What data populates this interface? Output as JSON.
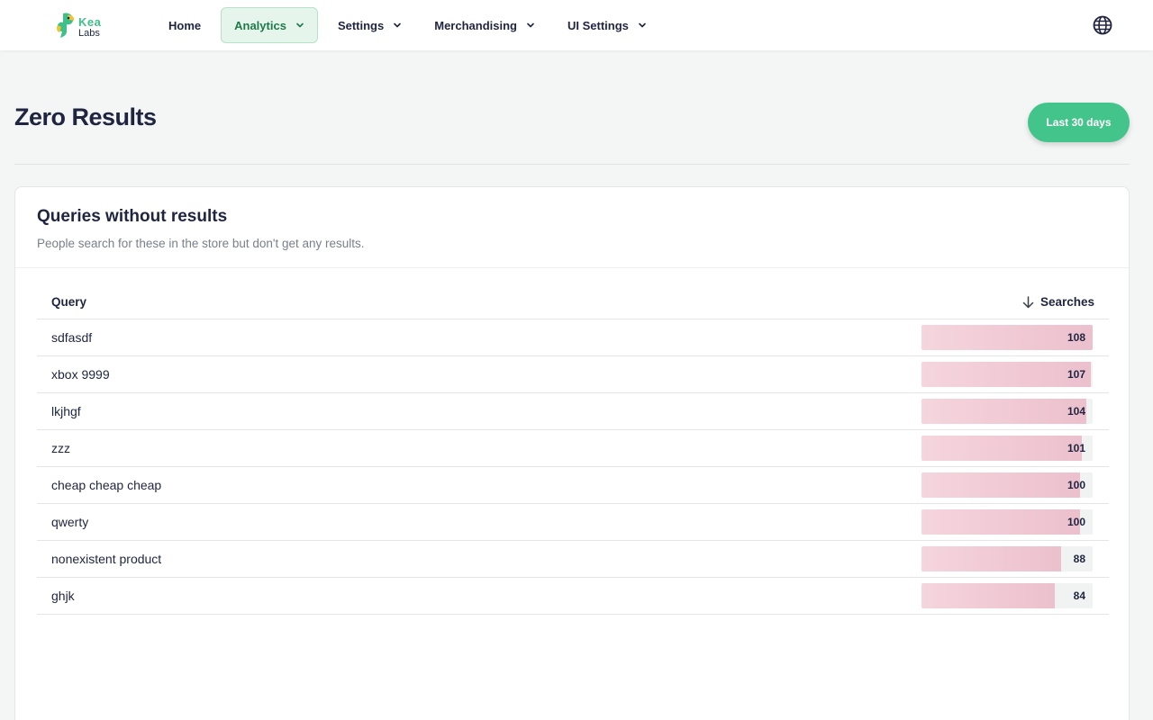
{
  "brand": {
    "name_top": "Kea",
    "name_bottom": "Labs"
  },
  "nav": {
    "items": [
      {
        "label": "Home",
        "has_dropdown": false,
        "active": false
      },
      {
        "label": "Analytics",
        "has_dropdown": true,
        "active": true
      },
      {
        "label": "Settings",
        "has_dropdown": true,
        "active": false
      },
      {
        "label": "Merchandising",
        "has_dropdown": true,
        "active": false
      },
      {
        "label": "UI Settings",
        "has_dropdown": true,
        "active": false
      }
    ],
    "language_icon": "globe-icon"
  },
  "page": {
    "title": "Zero Results",
    "range_button": "Last 30 days"
  },
  "card": {
    "title": "Queries without results",
    "subtitle": "People search for these in the store but don't get any results.",
    "columns": {
      "query": "Query",
      "searches": "Searches"
    },
    "sort_icon": "arrow-down-icon",
    "max_searches": 108,
    "rows": [
      {
        "query": "sdfasdf",
        "searches": 108
      },
      {
        "query": "xbox 9999",
        "searches": 107
      },
      {
        "query": "lkjhgf",
        "searches": 104
      },
      {
        "query": "zzz",
        "searches": 101
      },
      {
        "query": "cheap cheap cheap",
        "searches": 100
      },
      {
        "query": "qwerty",
        "searches": 100
      },
      {
        "query": "nonexistent product",
        "searches": 88
      },
      {
        "query": "ghjk",
        "searches": 84
      }
    ]
  },
  "colors": {
    "accent": "#43c48a",
    "active_nav_bg": "#e5f5ec",
    "bar_fill": "#ecc0cd",
    "text": "#1f2540"
  }
}
